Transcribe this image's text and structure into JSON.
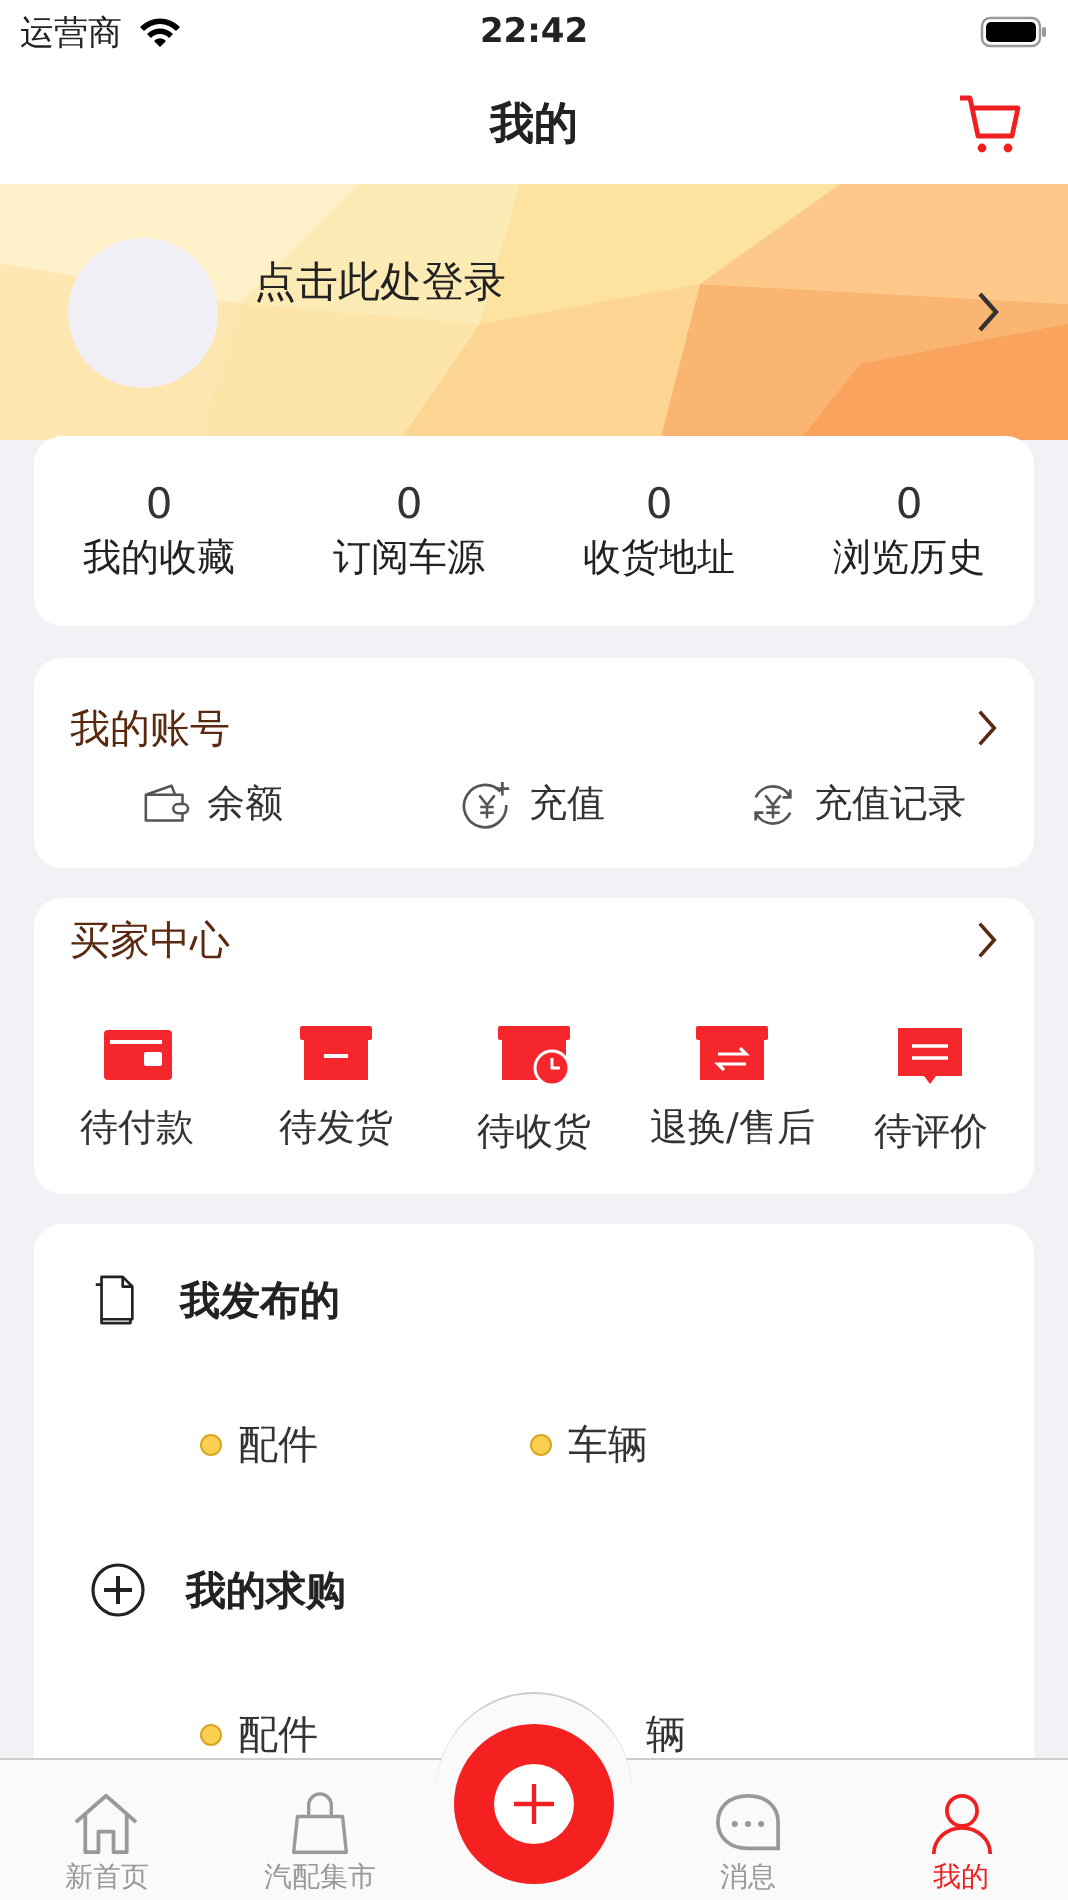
{
  "status_bar": {
    "carrier": "运营商",
    "time": "22:42"
  },
  "header": {
    "title": "我的"
  },
  "profile": {
    "login_text": "点击此处登录"
  },
  "stats": [
    {
      "count": "0",
      "label": "我的收藏"
    },
    {
      "count": "0",
      "label": "订阅车源"
    },
    {
      "count": "0",
      "label": "收货地址"
    },
    {
      "count": "0",
      "label": "浏览历史"
    }
  ],
  "account": {
    "title": "我的账号",
    "items": [
      {
        "kind": "wallet",
        "label": "余额"
      },
      {
        "kind": "recharge",
        "label": "充值"
      },
      {
        "kind": "history",
        "label": "充值记录"
      }
    ]
  },
  "buyer_center": {
    "title": "买家中心",
    "items": [
      {
        "kind": "card",
        "label": "待付款"
      },
      {
        "kind": "box",
        "label": "待发货"
      },
      {
        "kind": "clock",
        "label": "待收货"
      },
      {
        "kind": "swap",
        "label": "退换/售后"
      },
      {
        "kind": "comment",
        "label": "待评价"
      }
    ]
  },
  "sections": [
    {
      "kind": "published",
      "title": "我发布的",
      "items": [
        {
          "label": "配件",
          "bullet": true
        },
        {
          "label": "车辆",
          "bullet": true
        }
      ]
    },
    {
      "kind": "wanted",
      "title": "我的求购",
      "items": [
        {
          "label": "配件",
          "bullet": true
        },
        {
          "label": "辆",
          "bullet": false
        }
      ]
    }
  ],
  "tab_bar": [
    {
      "kind": "home",
      "label": "新首页",
      "selected": false
    },
    {
      "kind": "bag",
      "label": "汽配集市",
      "selected": false
    },
    {
      "kind": "add",
      "selected": false
    },
    {
      "kind": "chat",
      "label": "消息",
      "selected": false
    },
    {
      "kind": "user",
      "label": "我的",
      "selected": true
    }
  ]
}
